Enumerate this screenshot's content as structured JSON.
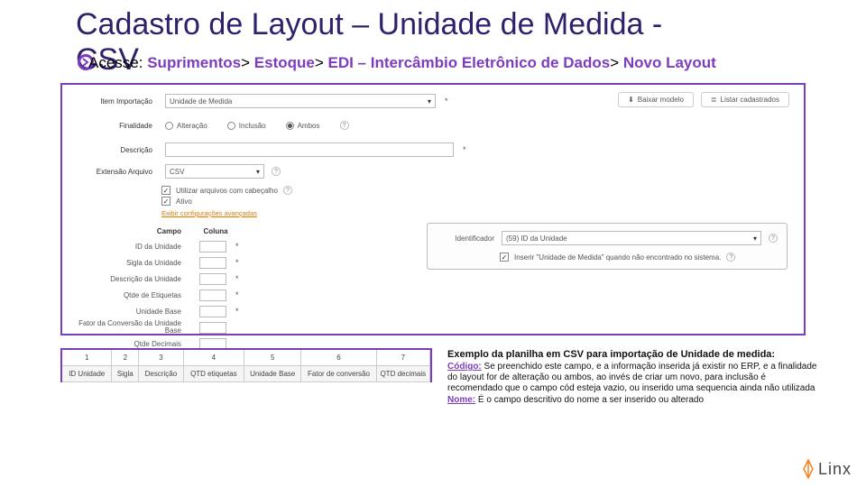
{
  "slide": {
    "title_l1": "Cadastro de Layout – Unidade de Medida -",
    "title_l2": "CSV"
  },
  "breadcrumb": {
    "prefix": "Acesse:",
    "path1": "Suprimentos",
    "path2": "Estoque",
    "path3": "EDI – Intercâmbio Eletrônico de Dados",
    "path4": "Novo Layout"
  },
  "form": {
    "item_label": "Item Importação",
    "item_value": "Unidade de Medida",
    "btn_download": "Baixar modelo",
    "btn_list": "Listar cadastrados",
    "purpose_label": "Finalidade",
    "radio1": "Alteração",
    "radio2": "Inclusão",
    "radio3": "Ambos",
    "desc_label": "Descrição",
    "ext_label": "Extensão Arquivo",
    "ext_value": "CSV",
    "cb1": "Utilizar arquivos com cabeçalho",
    "cb2": "Ativo",
    "advanced_link": "Exibir configurações avançadas"
  },
  "fields": {
    "head_campo": "Campo",
    "head_coluna": "Coluna",
    "rows": [
      {
        "label": "ID da Unidade"
      },
      {
        "label": "Sigla da Unidade"
      },
      {
        "label": "Descrição da Unidade"
      },
      {
        "label": "Qtde de Etiquetas"
      },
      {
        "label": "Unidade Base"
      },
      {
        "label": "Fator da Conversão da Unidade Base"
      },
      {
        "label": "Qtde Decimais"
      }
    ]
  },
  "inset": {
    "id_label": "Identificador",
    "id_value": "(59) ID da Unidade",
    "cb_label": "Inserir \"Unidade de Medida\" quando não encontrado no sistema."
  },
  "sheet": {
    "nums": [
      "1",
      "2",
      "3",
      "4",
      "5",
      "6",
      "7"
    ],
    "headers": [
      "ID Unidade",
      "Sigla",
      "Descrição",
      "QTD etiquetas",
      "Unidade Base",
      "Fator de conversão",
      "QTD decimais"
    ]
  },
  "explain": {
    "title": "Exemplo da planilha em CSV para importação de Unidade de medida:",
    "codigo_label": "Código:",
    "codigo_text": "Se preenchido este campo, e a informação inserida já existir no ERP, e a finalidade do layout for de alteração ou ambos, ao invés de criar um novo, para inclusão é recomendado que o campo cód esteja vazio, ou inserido uma sequencia ainda não utilizada",
    "nome_label": "Nome:",
    "nome_text": "É o campo descritivo do nome a ser inserido ou alterado"
  },
  "logo": "Linx"
}
